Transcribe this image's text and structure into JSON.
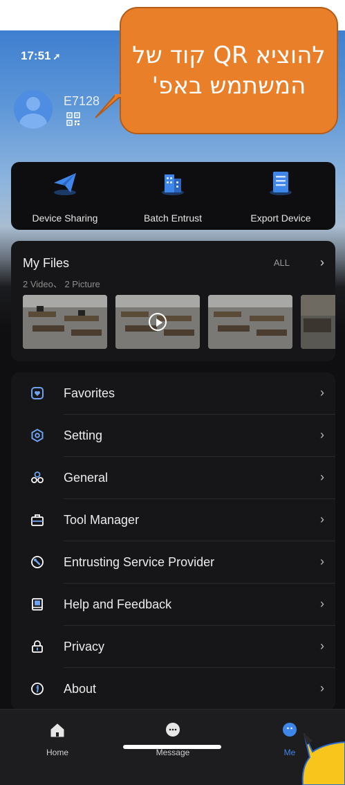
{
  "status_bar": {
    "time": "17:51",
    "location_glyph": "➚"
  },
  "profile": {
    "username": "E7128",
    "qr_icon": "qr-code-icon"
  },
  "callout": {
    "text": "להוציא QR קוד של המשתמש באפ'",
    "color": "#ea7f2a"
  },
  "quick_actions": [
    {
      "label": "Device Sharing",
      "icon": "paper-plane-icon"
    },
    {
      "label": "Batch Entrust",
      "icon": "building-icon"
    },
    {
      "label": "Export Device",
      "icon": "document-list-icon"
    }
  ],
  "files": {
    "title": "My Files",
    "all_label": "ALL",
    "chevron": "›",
    "summary": "2 Video、 2 Picture",
    "thumbnails": [
      {
        "type": "picture"
      },
      {
        "type": "video"
      },
      {
        "type": "picture"
      },
      {
        "type": "picture"
      }
    ]
  },
  "menu": [
    {
      "label": "Favorites",
      "icon": "heart-icon",
      "chevron": "›"
    },
    {
      "label": "Setting",
      "icon": "hexagon-settings-icon",
      "chevron": "›"
    },
    {
      "label": "General",
      "icon": "three-circles-icon",
      "chevron": "›"
    },
    {
      "label": "Tool Manager",
      "icon": "toolbox-icon",
      "chevron": "›"
    },
    {
      "label": "Entrusting Service Provider",
      "icon": "wrench-circle-icon",
      "chevron": "›"
    },
    {
      "label": "Help and Feedback",
      "icon": "book-icon",
      "chevron": "›"
    },
    {
      "label": "Privacy",
      "icon": "lock-icon",
      "chevron": "›"
    },
    {
      "label": "About",
      "icon": "info-icon",
      "chevron": "›"
    }
  ],
  "tabbar": [
    {
      "label": "Home",
      "icon": "home-icon",
      "active": false
    },
    {
      "label": "Message",
      "icon": "message-bubble-icon",
      "active": false
    },
    {
      "label": "Me",
      "icon": "me-dots-icon",
      "active": true
    }
  ],
  "colors": {
    "accent": "#3f86ea",
    "background": "#0f0f11",
    "card": "#161618",
    "callout": "#ea7f2a",
    "corner_shape": "#f8c51c"
  }
}
